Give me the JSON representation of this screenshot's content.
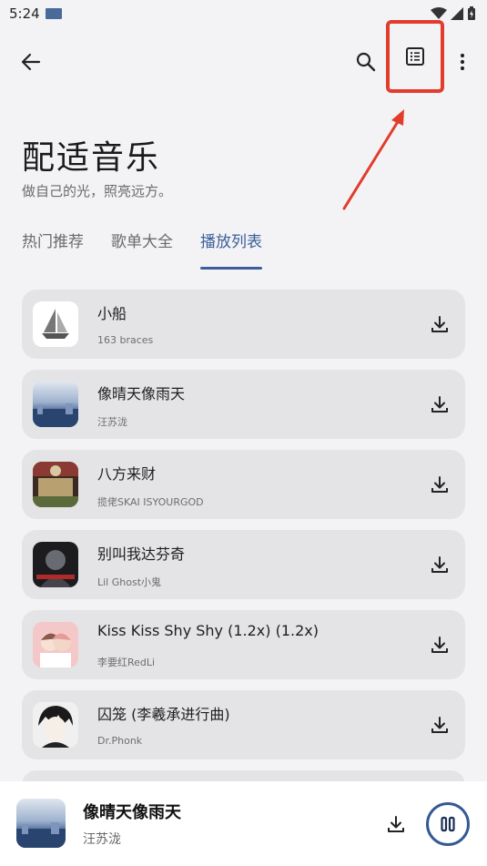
{
  "status_bar": {
    "time": "5:24"
  },
  "toolbar": {
    "back_icon": "arrow-left-icon",
    "search_icon": "search-icon",
    "list_icon": "list-icon",
    "more_icon": "more-vert-icon"
  },
  "header": {
    "title": "配适音乐",
    "subtitle": "做自己的光，照亮远方。"
  },
  "tabs": [
    {
      "label": "热门推荐",
      "active": false
    },
    {
      "label": "歌单大全",
      "active": false
    },
    {
      "label": "播放列表",
      "active": true
    }
  ],
  "songs": [
    {
      "title": "小船",
      "artist": "163 braces"
    },
    {
      "title": "像晴天像雨天",
      "artist": "汪苏泷"
    },
    {
      "title": "八方来财",
      "artist": "揽佬SKAI ISYOURGOD"
    },
    {
      "title": "别叫我达芬奇",
      "artist": "Lil Ghost小鬼"
    },
    {
      "title": "Kiss Kiss Shy Shy (1.2x) (1.2x)",
      "artist": "李要红RedLi"
    },
    {
      "title": "囚笼 (李羲承进行曲)",
      "artist": "Dr.Phonk"
    }
  ],
  "now_playing": {
    "title": "像晴天像雨天",
    "artist": "汪苏泷"
  },
  "colors": {
    "accent": "#3c5f9a",
    "highlight": "#e23c2c",
    "card": "#e4e4e7",
    "background": "#f3f3f5"
  }
}
